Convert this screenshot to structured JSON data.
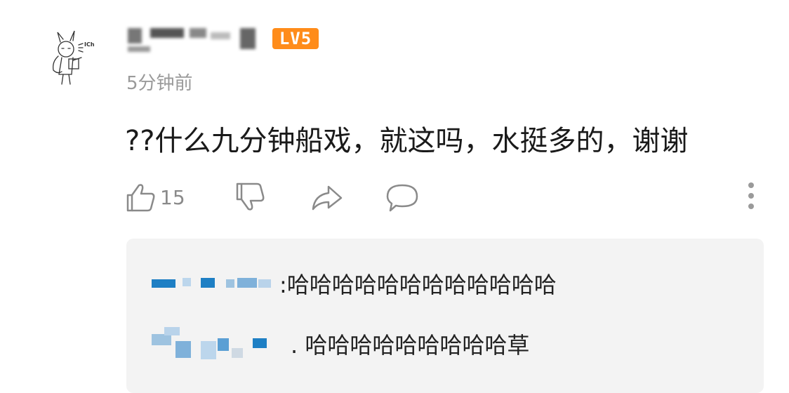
{
  "comment": {
    "level_badge": "LV5",
    "timestamp": "5分钟前",
    "text": "??什么九分钟船戏，就这吗，水挺多的，谢谢",
    "like_count": "15"
  },
  "replies": [
    {
      "text": ":哈哈哈哈哈哈哈哈哈哈哈哈"
    },
    {
      "text": ". 哈哈哈哈哈哈哈哈哈草"
    }
  ],
  "colors": {
    "badge": "#ff8c1a",
    "timestamp": "#9a9a9a",
    "reply_bg": "#f3f3f3",
    "username_blur": "#1e7fc4"
  }
}
